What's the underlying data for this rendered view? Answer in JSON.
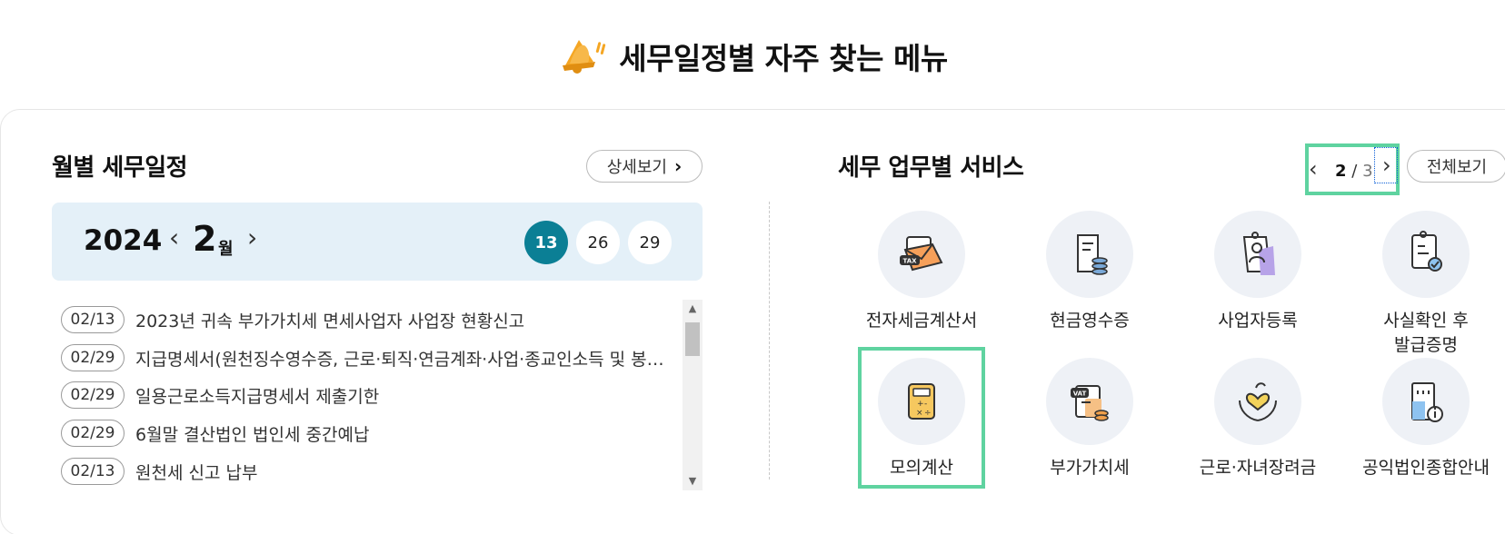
{
  "page": {
    "title": "세무일정별 자주 찾는 메뉴",
    "title_icon": "bell-icon"
  },
  "schedule": {
    "title": "월별 세무일정",
    "detail_button": "상세보기",
    "year": "2024",
    "month": "2",
    "month_unit": "월",
    "days": [
      {
        "label": "13",
        "active": true
      },
      {
        "label": "26",
        "active": false
      },
      {
        "label": "29",
        "active": false
      }
    ],
    "items": [
      {
        "date": "02/13",
        "text": "2023년 귀속 부가가치세 면세사업자 사업장 현황신고"
      },
      {
        "date": "02/29",
        "text": "지급명세서(원천징수영수증, 근로·퇴직·연금계좌·사업·종교인소득 및 봉사료)"
      },
      {
        "date": "02/29",
        "text": "일용근로소득지급명세서 제출기한"
      },
      {
        "date": "02/29",
        "text": "6월말 결산법인 법인세 중간예납"
      },
      {
        "date": "02/13",
        "text": "원천세 신고 납부"
      }
    ],
    "scroll_position": 0.05
  },
  "services": {
    "title": "세무 업무별 서비스",
    "pager": {
      "current": "2",
      "separator": "/",
      "total": "3"
    },
    "view_all_button": "전체보기",
    "items": [
      {
        "label": "전자세금계산서",
        "icon": "tax-envelope-icon"
      },
      {
        "label": "현금영수증",
        "icon": "receipt-coins-icon"
      },
      {
        "label": "사업자등록",
        "icon": "business-registration-icon"
      },
      {
        "label": "사실확인 후\n발급증명",
        "icon": "certificate-check-icon"
      },
      {
        "label": "모의계산",
        "icon": "calculator-icon"
      },
      {
        "label": "부가가치세",
        "icon": "vat-document-icon"
      },
      {
        "label": "근로·자녀장려금",
        "icon": "hands-heart-icon"
      },
      {
        "label": "공익법인종합안내",
        "icon": "building-info-icon"
      }
    ]
  },
  "colors": {
    "accent": "#0b7f95",
    "highlight": "#5fd3a0",
    "calendar_bg": "#e4f0f8",
    "icon_bg": "#eef1f6"
  }
}
